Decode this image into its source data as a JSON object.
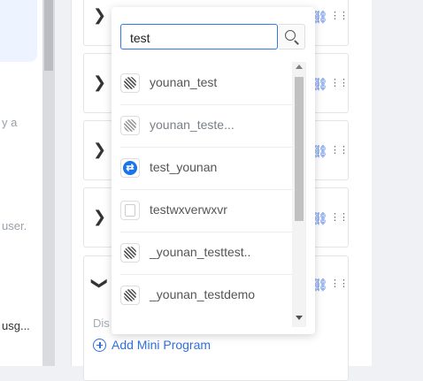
{
  "left_panel": {
    "snippets": [
      "y a",
      "user.",
      "usg..."
    ]
  },
  "config": {
    "row_icon": "link-icon",
    "drag_icon": "drag-handle-icon",
    "display_text": "Dis",
    "add_mini_program_label": "Add Mini Program"
  },
  "search": {
    "value": "test"
  },
  "results": [
    {
      "label": "younan_test",
      "avatar": "qr-avatar"
    },
    {
      "label": "younan_teste...",
      "avatar": "qr-avatar"
    },
    {
      "label": "test_younan",
      "avatar": "blue-logo",
      "logo_text": "⇄"
    },
    {
      "label": "testwxverwxvr",
      "avatar": "blank-avatar"
    },
    {
      "label": "_younan_testtest..",
      "avatar": "qr-avatar"
    },
    {
      "label": "_younan_testdemo",
      "avatar": "qr-avatar"
    }
  ],
  "colors": {
    "accent": "#2f6fe3",
    "focus_border": "#2f7be6"
  }
}
